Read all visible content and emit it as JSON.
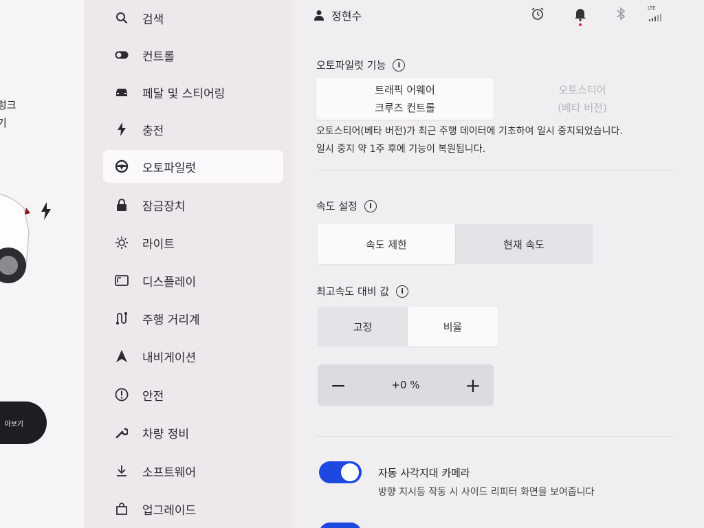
{
  "car_panel": {
    "lines": [
      "렁크",
      "기"
    ],
    "view_button": "아보기"
  },
  "sidebar": {
    "items": [
      {
        "label": "검색",
        "icon": "search-icon"
      },
      {
        "label": "컨트롤",
        "icon": "toggle-icon"
      },
      {
        "label": "페달 및 스티어링",
        "icon": "car-icon"
      },
      {
        "label": "충전",
        "icon": "bolt-icon"
      },
      {
        "label": "오토파일럿",
        "icon": "steering-wheel-icon",
        "active": true
      },
      {
        "label": "잠금장치",
        "icon": "lock-icon"
      },
      {
        "label": "라이트",
        "icon": "light-icon"
      },
      {
        "label": "디스플레이",
        "icon": "display-icon"
      },
      {
        "label": "주행 거리계",
        "icon": "trip-icon"
      },
      {
        "label": "내비게이션",
        "icon": "navigation-icon"
      },
      {
        "label": "안전",
        "icon": "safety-icon"
      },
      {
        "label": "차량 정비",
        "icon": "wrench-icon"
      },
      {
        "label": "소프트웨어",
        "icon": "download-icon"
      },
      {
        "label": "업그레이드",
        "icon": "bag-icon"
      }
    ]
  },
  "topbar": {
    "user_name": "정현수",
    "network": "LTE"
  },
  "autopilot": {
    "title": "오토파일럿 기능",
    "options": [
      "트래픽 어웨어\n크루즈 컨트롤",
      "오토스티어\n(베타 버전)"
    ],
    "description_1": "오토스티어(베타 버전)가 최근 주행 데이터에 기초하여 일시 중지되었습니다.",
    "description_2": "일시 중지 약 1주 후에 기능이 복원됩니다."
  },
  "speed_setting": {
    "title": "속도 설정",
    "options": [
      "속도 제한",
      "현재 속도"
    ]
  },
  "speed_offset": {
    "title": "최고속도 대비 값",
    "options": [
      "고정",
      "비율"
    ],
    "value": "+0 %",
    "minus": "−",
    "plus": "+"
  },
  "blind_spot": {
    "title": "자동 사각지대 카메라",
    "subtitle": "방향 지시등 작동 시 사이드 리피터 화면을 보여줍니다",
    "enabled": true
  },
  "colors": {
    "accent": "#1e49e0",
    "background": "#f1eef1",
    "sidebar": "#ece8ec"
  }
}
